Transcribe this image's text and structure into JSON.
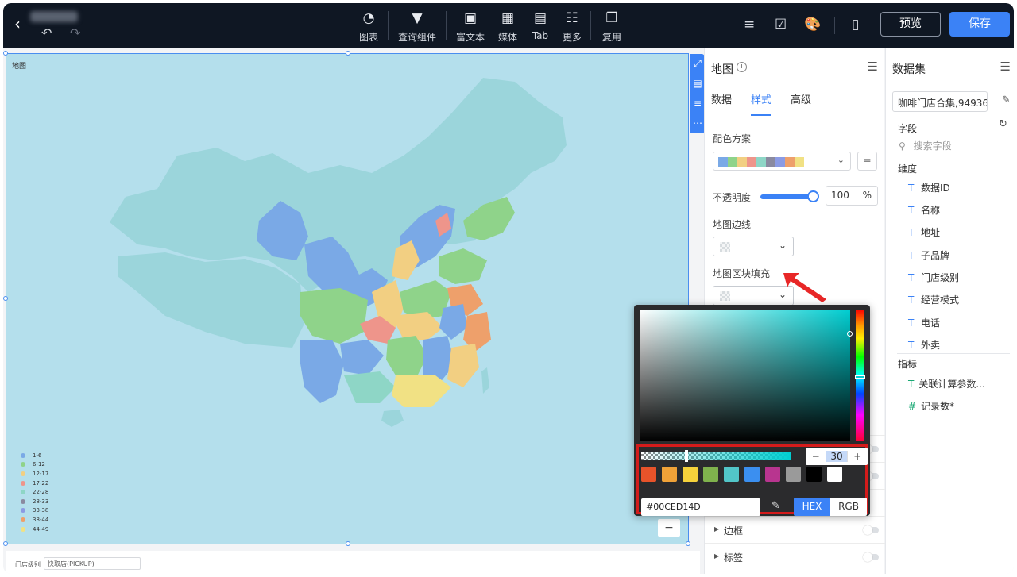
{
  "topbar": {
    "back_icon": "back-chevron",
    "tools": [
      {
        "label": "图表",
        "icon": "pie-chart-icon"
      },
      {
        "label": "查询组件",
        "icon": "filter-icon"
      },
      {
        "label": "富文本",
        "icon": "text-icon"
      },
      {
        "label": "媒体",
        "icon": "image-icon"
      },
      {
        "label": "Tab",
        "icon": "tab-icon"
      },
      {
        "label": "更多",
        "icon": "grid-icon"
      },
      {
        "label": "复用",
        "icon": "copy-icon"
      }
    ],
    "preview_label": "预览",
    "save_label": "保存"
  },
  "canvas": {
    "title": "地图",
    "legend": [
      {
        "label": "1-6",
        "color": "#7aa9e6"
      },
      {
        "label": "6-12",
        "color": "#8fd38a"
      },
      {
        "label": "12-17",
        "color": "#f2cf82"
      },
      {
        "label": "17-22",
        "color": "#ee958b"
      },
      {
        "label": "22-28",
        "color": "#8ed6c6"
      },
      {
        "label": "28-33",
        "color": "#8a8aa0"
      },
      {
        "label": "33-38",
        "color": "#8b9be4"
      },
      {
        "label": "38-44",
        "color": "#eea06b"
      },
      {
        "label": "44-49",
        "color": "#f1e184"
      }
    ],
    "filter_label": "门店级别",
    "filter_value": "快取店(PICKUP)",
    "zoom_out": "−"
  },
  "settings": {
    "title": "地图",
    "tabs": [
      "数据",
      "样式",
      "高级"
    ],
    "active_tab": "样式",
    "color_scheme_label": "配色方案",
    "palette": [
      "#7aa9e6",
      "#8fd38a",
      "#f2cf82",
      "#ee958b",
      "#8ed6c6",
      "#8a8aa0",
      "#8b9be4",
      "#eea06b",
      "#f1e184"
    ],
    "opacity_label": "不透明度",
    "opacity_value": "100",
    "opacity_unit": "%",
    "border_label": "地图边线",
    "fill_label": "地图区块填充",
    "collapsed": [
      {
        "label": "边框"
      },
      {
        "label": "标签"
      }
    ]
  },
  "dataset": {
    "title": "数据集",
    "selected": "咖啡门店合集,94936",
    "fields_label": "字段",
    "search_placeholder": "搜索字段",
    "dimension_label": "维度",
    "dimensions": [
      "数据ID",
      "名称",
      "地址",
      "子品牌",
      "门店级别",
      "经营模式",
      "电话",
      "外卖"
    ],
    "measure_label": "指标",
    "measures": [
      {
        "type": "calc",
        "label": "关联计算参数..."
      },
      {
        "type": "number",
        "label": "记录数*"
      }
    ]
  },
  "picker": {
    "hex_value": "#00CED14D",
    "alpha_value": "30",
    "minus": "−",
    "plus": "+",
    "mode_hex": "HEX",
    "mode_rgb": "RGB",
    "presets": [
      "#e8532a",
      "#f0a238",
      "#f6d23b",
      "#7fb24d",
      "#52c5c8",
      "#3b8ff0",
      "#b8358f",
      "#9a9a9a",
      "#000000",
      "#ffffff"
    ]
  }
}
